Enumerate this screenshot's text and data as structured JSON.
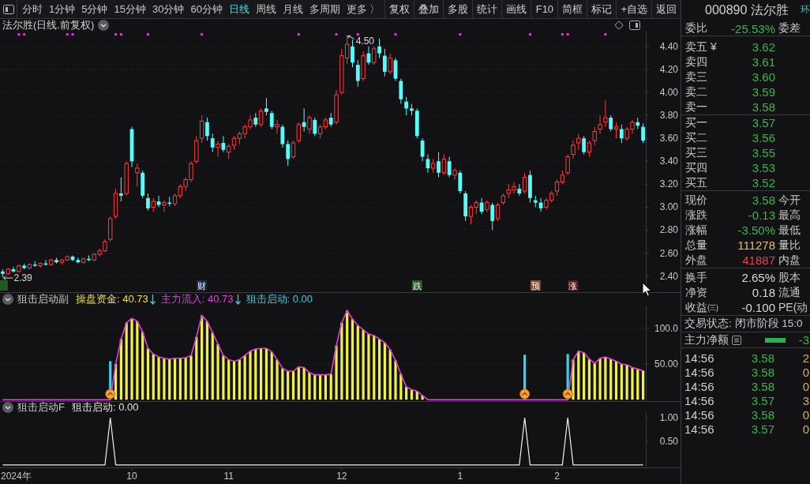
{
  "toolbar": {
    "tabs": [
      {
        "label": "分时",
        "selected": false
      },
      {
        "label": "1分钟",
        "selected": false
      },
      {
        "label": "5分钟",
        "selected": false
      },
      {
        "label": "15分钟",
        "selected": false
      },
      {
        "label": "30分钟",
        "selected": false
      },
      {
        "label": "60分钟",
        "selected": false
      },
      {
        "label": "日线",
        "selected": true
      },
      {
        "label": "周线",
        "selected": false
      },
      {
        "label": "月线",
        "selected": false
      },
      {
        "label": "多周期",
        "selected": false
      },
      {
        "label": "更多 〉",
        "selected": false
      }
    ],
    "buttons": [
      "复权",
      "叠加",
      "多股",
      "统计",
      "画线",
      "F10",
      "简框",
      "标记",
      "+自选",
      "返回"
    ]
  },
  "main_chart": {
    "title": "法尔胜(日线.前复权)",
    "max_label": "4.50",
    "min_label": "2.39",
    "info_marks": [
      false,
      false,
      false,
      true,
      true,
      false,
      false,
      false,
      false,
      false,
      false,
      false,
      true,
      true,
      false,
      false,
      false,
      false,
      false,
      false,
      false,
      true,
      true,
      false,
      false,
      false,
      false,
      true,
      false,
      false,
      false,
      false,
      false,
      false,
      false,
      false,
      false,
      true,
      false,
      false,
      false,
      false,
      false,
      false,
      false,
      false,
      false,
      false,
      false,
      false,
      false,
      false,
      false,
      false,
      false,
      true,
      false,
      false,
      false,
      false,
      false,
      false,
      true,
      false,
      false,
      false,
      true,
      false,
      false,
      false,
      false,
      false,
      false,
      true,
      false,
      false,
      false,
      false,
      false,
      false,
      false,
      false,
      false,
      false,
      false,
      true,
      false,
      false,
      false,
      false,
      false,
      false,
      false,
      false,
      false,
      false,
      false,
      false,
      true,
      false,
      false,
      false,
      false,
      false,
      true,
      true,
      false,
      false,
      false,
      false,
      false,
      false,
      true,
      false,
      false,
      false,
      false,
      false,
      false,
      false
    ],
    "event_tags": [
      {
        "color": "#1f5c24"
      },
      {
        "text": "财",
        "color": "#16304f"
      },
      {
        "text": "跌",
        "color": "#1f5c24"
      },
      {
        "text": "预",
        "color": "#8c4c26"
      },
      {
        "text": "涨",
        "color": "#5c1a1a"
      }
    ],
    "chart_data": [
      {
        "type": "candlestick",
        "ylim": [
          2.26,
          4.53
        ],
        "yticks": [
          {
            "value": 4.4,
            "label": "4.40"
          },
          {
            "value": 4.2,
            "label": "4.20"
          },
          {
            "value": 4.0,
            "label": "4.00"
          },
          {
            "value": 3.8,
            "label": "3.80"
          },
          {
            "value": 3.6,
            "label": "3.60"
          },
          {
            "value": 3.4,
            "label": "3.40"
          },
          {
            "value": 3.2,
            "label": "3.20"
          },
          {
            "value": 3.0,
            "label": "3.00"
          },
          {
            "value": 2.8,
            "label": "2.80"
          },
          {
            "value": 2.6,
            "label": "2.60"
          },
          {
            "value": 2.4,
            "label": "2.40"
          }
        ],
        "grid": true,
        "ohlc": [
          [
            2.44,
            2.46,
            2.39,
            2.42
          ],
          [
            2.42,
            2.47,
            2.41,
            2.46
          ],
          [
            2.46,
            2.48,
            2.43,
            2.44
          ],
          [
            2.44,
            2.5,
            2.43,
            2.49
          ],
          [
            2.49,
            2.51,
            2.46,
            2.47
          ],
          [
            2.47,
            2.51,
            2.46,
            2.5
          ],
          [
            2.5,
            2.53,
            2.48,
            2.49
          ],
          [
            2.49,
            2.52,
            2.47,
            2.51
          ],
          [
            2.51,
            2.54,
            2.49,
            2.5
          ],
          [
            2.5,
            2.55,
            2.49,
            2.54
          ],
          [
            2.54,
            2.56,
            2.51,
            2.52
          ],
          [
            2.52,
            2.55,
            2.5,
            2.54
          ],
          [
            2.54,
            2.58,
            2.53,
            2.57
          ],
          [
            2.57,
            2.58,
            2.53,
            2.54
          ],
          [
            2.54,
            2.56,
            2.51,
            2.52
          ],
          [
            2.52,
            2.56,
            2.51,
            2.55
          ],
          [
            2.55,
            2.58,
            2.53,
            2.54
          ],
          [
            2.54,
            2.6,
            2.53,
            2.59
          ],
          [
            2.59,
            2.64,
            2.57,
            2.62
          ],
          [
            2.62,
            2.72,
            2.61,
            2.7
          ],
          [
            2.72,
            2.92,
            2.7,
            2.9
          ],
          [
            2.92,
            3.16,
            2.9,
            3.12
          ],
          [
            3.12,
            3.26,
            3.05,
            3.1
          ],
          [
            3.12,
            3.4,
            3.1,
            3.38
          ],
          [
            3.68,
            3.7,
            3.35,
            3.4
          ],
          [
            3.3,
            3.38,
            3.18,
            3.34
          ],
          [
            3.3,
            3.32,
            3.08,
            3.1
          ],
          [
            3.08,
            3.12,
            2.97,
            2.99
          ],
          [
            3.0,
            3.08,
            2.96,
            3.05
          ],
          [
            3.05,
            3.1,
            3.0,
            3.02
          ],
          [
            3.02,
            3.06,
            2.96,
            3.04
          ],
          [
            3.04,
            3.09,
            3.01,
            3.03
          ],
          [
            3.03,
            3.12,
            3.01,
            3.1
          ],
          [
            3.1,
            3.2,
            3.08,
            3.18
          ],
          [
            3.18,
            3.26,
            3.14,
            3.24
          ],
          [
            3.24,
            3.4,
            3.22,
            3.38
          ],
          [
            3.4,
            3.62,
            3.38,
            3.58
          ],
          [
            3.6,
            3.8,
            3.56,
            3.75
          ],
          [
            3.74,
            3.78,
            3.58,
            3.62
          ],
          [
            3.6,
            3.64,
            3.48,
            3.52
          ],
          [
            3.52,
            3.58,
            3.44,
            3.55
          ],
          [
            3.56,
            3.62,
            3.48,
            3.5
          ],
          [
            3.48,
            3.55,
            3.42,
            3.53
          ],
          [
            3.54,
            3.62,
            3.5,
            3.6
          ],
          [
            3.6,
            3.66,
            3.55,
            3.64
          ],
          [
            3.64,
            3.72,
            3.6,
            3.7
          ],
          [
            3.7,
            3.8,
            3.68,
            3.76
          ],
          [
            3.78,
            3.82,
            3.7,
            3.72
          ],
          [
            3.72,
            3.86,
            3.7,
            3.84
          ],
          [
            3.86,
            3.95,
            3.8,
            3.83
          ],
          [
            3.82,
            3.84,
            3.68,
            3.7
          ],
          [
            3.7,
            3.76,
            3.64,
            3.72
          ],
          [
            3.7,
            3.72,
            3.52,
            3.55
          ],
          [
            3.55,
            3.58,
            3.36,
            3.42
          ],
          [
            3.44,
            3.58,
            3.42,
            3.56
          ],
          [
            3.58,
            3.74,
            3.56,
            3.72
          ],
          [
            3.74,
            3.86,
            3.66,
            3.7
          ],
          [
            3.68,
            3.8,
            3.64,
            3.78
          ],
          [
            3.76,
            3.78,
            3.62,
            3.64
          ],
          [
            3.64,
            3.72,
            3.6,
            3.7
          ],
          [
            3.7,
            3.78,
            3.68,
            3.76
          ],
          [
            3.78,
            3.82,
            3.7,
            3.72
          ],
          [
            3.74,
            4.02,
            3.72,
            3.98
          ],
          [
            4.0,
            4.38,
            3.98,
            4.32
          ],
          [
            4.3,
            4.5,
            4.25,
            4.42
          ],
          [
            4.4,
            4.46,
            4.22,
            4.26
          ],
          [
            4.24,
            4.28,
            4.05,
            4.1
          ],
          [
            4.12,
            4.36,
            4.1,
            4.32
          ],
          [
            4.34,
            4.4,
            4.24,
            4.26
          ],
          [
            4.26,
            4.4,
            4.24,
            4.38
          ],
          [
            4.4,
            4.47,
            4.3,
            4.34
          ],
          [
            4.32,
            4.38,
            4.14,
            4.18
          ],
          [
            4.18,
            4.34,
            4.16,
            4.3
          ],
          [
            4.28,
            4.3,
            4.1,
            4.12
          ],
          [
            4.1,
            4.12,
            3.9,
            3.94
          ],
          [
            3.92,
            3.96,
            3.8,
            3.86
          ],
          [
            3.86,
            3.9,
            3.8,
            3.84
          ],
          [
            3.84,
            3.86,
            3.6,
            3.62
          ],
          [
            3.58,
            3.6,
            3.4,
            3.44
          ],
          [
            3.42,
            3.46,
            3.3,
            3.34
          ],
          [
            3.34,
            3.42,
            3.3,
            3.38
          ],
          [
            3.4,
            3.48,
            3.26,
            3.3
          ],
          [
            3.3,
            3.46,
            3.28,
            3.42
          ],
          [
            3.4,
            3.44,
            3.26,
            3.28
          ],
          [
            3.28,
            3.34,
            3.24,
            3.32
          ],
          [
            3.3,
            3.32,
            3.12,
            3.14
          ],
          [
            3.12,
            3.14,
            2.88,
            2.92
          ],
          [
            2.92,
            3.02,
            2.85,
            3.0
          ],
          [
            3.0,
            3.06,
            2.94,
            3.04
          ],
          [
            3.04,
            3.08,
            2.94,
            2.96
          ],
          [
            2.98,
            3.06,
            2.96,
            3.04
          ],
          [
            3.02,
            3.04,
            2.8,
            2.88
          ],
          [
            2.9,
            3.04,
            2.88,
            3.02
          ],
          [
            3.04,
            3.12,
            3.02,
            3.1
          ],
          [
            3.12,
            3.2,
            3.08,
            3.15
          ],
          [
            3.15,
            3.22,
            3.12,
            3.18
          ],
          [
            3.16,
            3.2,
            3.1,
            3.12
          ],
          [
            3.14,
            3.3,
            3.12,
            3.26
          ],
          [
            3.28,
            3.32,
            3.04,
            3.08
          ],
          [
            3.06,
            3.1,
            3.0,
            3.04
          ],
          [
            3.04,
            3.08,
            2.96,
            2.99
          ],
          [
            3.0,
            3.08,
            2.98,
            3.06
          ],
          [
            3.06,
            3.14,
            3.04,
            3.12
          ],
          [
            3.14,
            3.24,
            3.1,
            3.22
          ],
          [
            3.22,
            3.32,
            3.2,
            3.28
          ],
          [
            3.3,
            3.46,
            3.28,
            3.44
          ],
          [
            3.46,
            3.58,
            3.42,
            3.54
          ],
          [
            3.56,
            3.64,
            3.5,
            3.6
          ],
          [
            3.6,
            3.62,
            3.46,
            3.48
          ],
          [
            3.48,
            3.58,
            3.44,
            3.56
          ],
          [
            3.58,
            3.7,
            3.54,
            3.66
          ],
          [
            3.68,
            3.8,
            3.64,
            3.72
          ],
          [
            3.74,
            3.93,
            3.7,
            3.78
          ],
          [
            3.78,
            3.8,
            3.66,
            3.68
          ],
          [
            3.68,
            3.74,
            3.6,
            3.7
          ],
          [
            3.68,
            3.72,
            3.56,
            3.6
          ],
          [
            3.6,
            3.7,
            3.58,
            3.68
          ],
          [
            3.68,
            3.76,
            3.64,
            3.74
          ],
          [
            3.74,
            3.78,
            3.68,
            3.71
          ],
          [
            3.7,
            3.73,
            3.56,
            3.58
          ]
        ]
      }
    ]
  },
  "indicator_pane": {
    "name": "狙击启动副",
    "legend": [
      {
        "label": "操盘资金: 40.73",
        "color": "#e6e04a",
        "falling": true
      },
      {
        "label": "主力流入: 40.73",
        "color": "#e040e0",
        "falling": true
      },
      {
        "label": "狙击启动: 0.00",
        "color": "#3cc8d8",
        "falling": false
      }
    ],
    "chart_data": [
      {
        "type": "bar",
        "ylim": [
          -2,
          132
        ],
        "yticks": [
          {
            "value": 100,
            "label": "100.0"
          },
          {
            "value": 50,
            "label": "50.00"
          }
        ],
        "grid": true,
        "series": [
          {
            "type": "bar",
            "color": "#f2f040",
            "values": [
              0,
              0,
              0,
              0,
              0,
              0,
              0,
              0,
              0,
              0,
              0,
              0,
              0,
              0,
              0,
              0,
              0,
              0,
              0,
              0,
              0,
              50,
              85,
              108,
              114,
              110,
              95,
              72,
              64,
              60,
              58,
              57,
              58,
              58,
              59,
              62,
              88,
              118,
              110,
              94,
              78,
              62,
              56,
              54,
              56,
              62,
              68,
              71,
              72,
              72,
              67,
              56,
              44,
              40,
              40,
              46,
              45,
              38,
              35,
              35,
              35,
              36,
              76,
              108,
              125,
              113,
              104,
              98,
              92,
              90,
              85,
              80,
              70,
              55,
              36,
              18,
              14,
              12,
              6,
              0,
              0,
              0,
              0,
              0,
              0,
              0,
              0,
              0,
              0,
              0,
              0,
              0,
              0,
              0,
              0,
              0,
              0,
              0,
              0,
              0,
              0,
              0,
              0,
              0,
              0,
              0,
              56,
              68,
              66,
              57,
              51,
              58,
              60,
              57,
              54,
              50,
              49,
              45,
              43,
              40.73
            ]
          },
          {
            "type": "bar",
            "color": "#40d0e8",
            "values": [
              null,
              null,
              null,
              null,
              null,
              null,
              null,
              null,
              null,
              null,
              null,
              null,
              null,
              null,
              null,
              null,
              null,
              null,
              null,
              null,
              54,
              null,
              null,
              null,
              null,
              null,
              null,
              null,
              null,
              null,
              null,
              null,
              null,
              null,
              null,
              null,
              null,
              null,
              null,
              null,
              null,
              null,
              null,
              null,
              null,
              null,
              null,
              null,
              null,
              null,
              null,
              null,
              null,
              null,
              null,
              null,
              null,
              null,
              null,
              null,
              null,
              null,
              null,
              null,
              null,
              null,
              null,
              null,
              null,
              null,
              null,
              null,
              null,
              null,
              null,
              null,
              null,
              null,
              null,
              null,
              null,
              null,
              null,
              null,
              null,
              null,
              null,
              null,
              null,
              null,
              null,
              null,
              null,
              null,
              null,
              null,
              null,
              63,
              null,
              null,
              null,
              null,
              null,
              null,
              null,
              64,
              null,
              null,
              null,
              null,
              null,
              null,
              null,
              null,
              null,
              null,
              null,
              null,
              null,
              null
            ]
          },
          {
            "type": "line",
            "color": "#e040e0",
            "values": [
              0,
              0,
              0,
              0,
              0,
              0,
              0,
              0,
              0,
              0,
              0,
              0,
              0,
              0,
              0,
              0,
              0,
              0,
              0,
              0,
              0,
              50,
              85,
              108,
              114,
              110,
              95,
              72,
              64,
              60,
              58,
              57,
              58,
              58,
              59,
              62,
              88,
              118,
              110,
              94,
              78,
              62,
              56,
              54,
              56,
              62,
              68,
              71,
              72,
              72,
              67,
              56,
              44,
              40,
              40,
              46,
              45,
              38,
              35,
              35,
              35,
              36,
              76,
              108,
              125,
              113,
              104,
              98,
              92,
              90,
              85,
              80,
              70,
              55,
              36,
              18,
              14,
              12,
              6,
              0,
              0,
              0,
              0,
              0,
              0,
              0,
              0,
              0,
              0,
              0,
              0,
              0,
              0,
              0,
              0,
              0,
              0,
              0,
              0,
              0,
              0,
              0,
              0,
              0,
              0,
              0,
              56,
              68,
              66,
              57,
              51,
              58,
              60,
              57,
              54,
              50,
              49,
              45,
              43,
              40.73
            ]
          },
          {
            "type": "scatter",
            "color": "#f2a634",
            "marker": "circle",
            "values": [
              null,
              null,
              null,
              null,
              null,
              null,
              null,
              null,
              null,
              null,
              null,
              null,
              null,
              null,
              null,
              null,
              null,
              null,
              null,
              null,
              8,
              null,
              null,
              null,
              null,
              null,
              null,
              null,
              null,
              null,
              null,
              null,
              null,
              null,
              null,
              null,
              null,
              null,
              null,
              null,
              null,
              null,
              null,
              null,
              null,
              null,
              null,
              null,
              null,
              null,
              null,
              null,
              null,
              null,
              null,
              null,
              null,
              null,
              null,
              null,
              null,
              null,
              null,
              null,
              null,
              null,
              null,
              null,
              null,
              null,
              null,
              null,
              null,
              null,
              null,
              null,
              null,
              null,
              null,
              null,
              null,
              null,
              null,
              null,
              null,
              null,
              null,
              null,
              null,
              null,
              null,
              null,
              null,
              null,
              null,
              null,
              null,
              8,
              null,
              null,
              null,
              null,
              null,
              null,
              null,
              8,
              null,
              null,
              null,
              null,
              null,
              null,
              null,
              null,
              null,
              null,
              null,
              null,
              null,
              null
            ]
          }
        ]
      }
    ]
  },
  "signal_pane": {
    "name": "狙击启动F",
    "legend": [
      {
        "label": "狙击启动: 0.00",
        "color": "#e0e0e0",
        "falling": false
      }
    ],
    "chart_data": [
      {
        "type": "line",
        "ylim": [
          -0.02,
          1.1
        ],
        "yticks": [
          {
            "value": 1,
            "label": "1.00"
          },
          {
            "value": 0.5,
            "label": "0.50"
          }
        ],
        "color": "#f0f0f0",
        "xlabel": "2024年",
        "categories": [
          null,
          null,
          null,
          null,
          null,
          null,
          null,
          null,
          null,
          null,
          null,
          null,
          null,
          null,
          null,
          null,
          null,
          null,
          null,
          null,
          null,
          null,
          null,
          null,
          "10",
          null,
          null,
          null,
          null,
          null,
          null,
          null,
          null,
          null,
          null,
          null,
          null,
          null,
          null,
          null,
          null,
          null,
          "11",
          null,
          null,
          null,
          null,
          null,
          null,
          null,
          null,
          null,
          null,
          null,
          null,
          null,
          null,
          null,
          null,
          null,
          null,
          null,
          null,
          "12",
          null,
          null,
          null,
          null,
          null,
          null,
          null,
          null,
          null,
          null,
          null,
          null,
          null,
          null,
          null,
          null,
          null,
          null,
          null,
          null,
          null,
          "1",
          null,
          null,
          null,
          null,
          null,
          null,
          null,
          null,
          null,
          null,
          null,
          null,
          null,
          null,
          null,
          null,
          null,
          "2",
          null,
          null,
          null,
          null,
          null,
          null,
          null,
          null,
          null,
          null,
          null,
          null,
          null,
          null,
          null,
          null
        ],
        "values": [
          0,
          0,
          0,
          0,
          0,
          0,
          0,
          0,
          0,
          0,
          0,
          0,
          0,
          0,
          0,
          0,
          0,
          0,
          0,
          0,
          1,
          0,
          0,
          0,
          0,
          0,
          0,
          0,
          0,
          0,
          0,
          0,
          0,
          0,
          0,
          0,
          0,
          0,
          0,
          0,
          0,
          0,
          0,
          0,
          0,
          0,
          0,
          0,
          0,
          0,
          0,
          0,
          0,
          0,
          0,
          0,
          0,
          0,
          0,
          0,
          0,
          0,
          0,
          0,
          0,
          0,
          0,
          0,
          0,
          0,
          0,
          0,
          0,
          0,
          0,
          0,
          0,
          0,
          0,
          0,
          0,
          0,
          0,
          0,
          0,
          0,
          0,
          0,
          0,
          0,
          0,
          0,
          0,
          0,
          0,
          0,
          0,
          1,
          0,
          0,
          0,
          0,
          0,
          0,
          0,
          1,
          0,
          0,
          0,
          0,
          0,
          0,
          0,
          0,
          0,
          0,
          0,
          0,
          0,
          0
        ]
      }
    ]
  },
  "quote_panel": {
    "title": "000890 法尔胜",
    "sector": "环",
    "ratio": {
      "label": "委比",
      "value": "-25.53%",
      "color": "#3cb54a",
      "label2": "委差"
    },
    "asks": [
      {
        "label": "卖五 ¥",
        "price": "3.62"
      },
      {
        "label": "卖四",
        "price": "3.61"
      },
      {
        "label": "卖三",
        "price": "3.60"
      },
      {
        "label": "卖二",
        "price": "3.59"
      },
      {
        "label": "卖一",
        "price": "3.58"
      }
    ],
    "bids": [
      {
        "label": "买一",
        "price": "3.57"
      },
      {
        "label": "买二",
        "price": "3.56"
      },
      {
        "label": "买三",
        "price": "3.55"
      },
      {
        "label": "买四",
        "price": "3.53"
      },
      {
        "label": "买五",
        "price": "3.52"
      }
    ],
    "stats": [
      {
        "label": "现价",
        "value": "3.58",
        "color": "#3cb54a",
        "label2": "今开"
      },
      {
        "label": "涨跌",
        "value": "-0.13",
        "color": "#3cb54a",
        "label2": "最高"
      },
      {
        "label": "涨幅",
        "value": "-3.50%",
        "color": "#3cb54a",
        "label2": "最低"
      },
      {
        "label": "总量",
        "value": "111278",
        "color": "#e6bc6e",
        "label2": "量比"
      },
      {
        "label": "外盘",
        "value": "41887",
        "color": "#e8404e",
        "label2": "内盘"
      }
    ],
    "fundamentals": [
      {
        "label": "换手",
        "value": "2.65%",
        "label2": "股本"
      },
      {
        "label": "净资",
        "value": "0.18",
        "label2": "流通"
      },
      {
        "label": "收益㈢",
        "value": "-0.100",
        "label2": "PE(动"
      }
    ],
    "trade_status": "交易状态: 闭市阶段 15:0",
    "main_flow": {
      "label": "主力净额",
      "value": "-3"
    },
    "ticks": [
      {
        "time": "14:56",
        "price": "3.58",
        "volume": "2"
      },
      {
        "time": "14:56",
        "price": "3.58",
        "volume": "0"
      },
      {
        "time": "14:56",
        "price": "3.58",
        "volume": "0"
      },
      {
        "time": "14:56",
        "price": "3.57",
        "volume": "3"
      },
      {
        "time": "14:56",
        "price": "3.58",
        "volume": "0"
      },
      {
        "time": "14:56",
        "price": "3.57",
        "volume": "0"
      }
    ]
  }
}
